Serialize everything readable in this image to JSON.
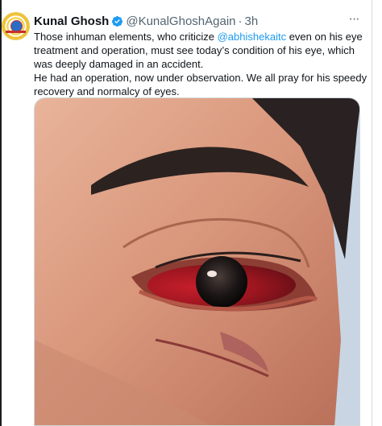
{
  "tweet": {
    "display_name": "Kunal Ghosh",
    "handle": "@KunalGhoshAgain",
    "separator": "·",
    "time": "3h",
    "more_label": "···",
    "text_before_mention": "Those inhuman elements, who criticize ",
    "mention": "@abhishekaitc",
    "text_after_mention": " even on his eye treatment and operation, must see today’s condition of his eye, which was deeply damaged in an accident.",
    "text_second_line": "He had an operation, now under observation. We all pray for his speedy recovery and normalcy of eyes."
  },
  "icons": {
    "verified": "verified-badge-icon",
    "more": "more-options-icon"
  },
  "colors": {
    "accent": "#1d9bf0",
    "text_primary": "#0f1419",
    "text_secondary": "#536471",
    "border": "#cfd9de"
  }
}
